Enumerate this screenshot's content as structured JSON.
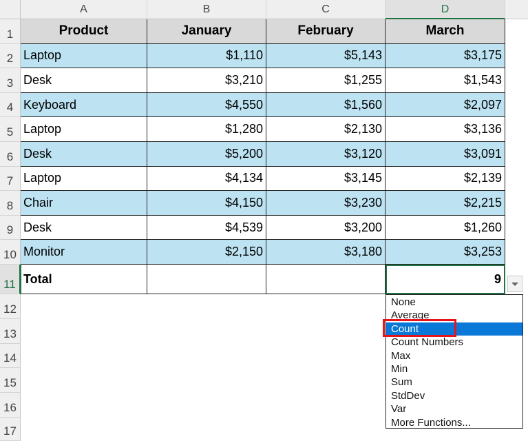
{
  "columns": [
    "A",
    "B",
    "C",
    "D"
  ],
  "rows_labels": [
    "1",
    "2",
    "3",
    "4",
    "5",
    "6",
    "7",
    "8",
    "9",
    "10",
    "11",
    "12",
    "13",
    "14",
    "15",
    "16",
    "17"
  ],
  "header": [
    "Product",
    "January",
    "February",
    "March"
  ],
  "data": [
    [
      "Laptop",
      "$1,110",
      "$5,143",
      "$3,175"
    ],
    [
      "Desk",
      "$3,210",
      "$1,255",
      "$1,543"
    ],
    [
      "Keyboard",
      "$4,550",
      "$1,560",
      "$2,097"
    ],
    [
      "Laptop",
      "$1,280",
      "$2,130",
      "$3,136"
    ],
    [
      "Desk",
      "$5,200",
      "$3,120",
      "$3,091"
    ],
    [
      "Laptop",
      "$4,134",
      "$3,145",
      "$2,139"
    ],
    [
      "Chair",
      "$4,150",
      "$3,230",
      "$2,215"
    ],
    [
      "Desk",
      "$4,539",
      "$3,200",
      "$1,260"
    ],
    [
      "Monitor",
      "$2,150",
      "$3,180",
      "$3,253"
    ]
  ],
  "total": {
    "label": "Total",
    "b": "",
    "c": "",
    "d": "9"
  },
  "dropdown": {
    "items": [
      "None",
      "Average",
      "Count",
      "Count Numbers",
      "Max",
      "Min",
      "Sum",
      "StdDev",
      "Var",
      "More Functions..."
    ],
    "selected": "Count"
  },
  "colors": {
    "band": "#bde3f3",
    "header": "#d9d9d9",
    "highlight": "#0a78d7",
    "annotation": "#e8141b",
    "active": "#217346"
  }
}
